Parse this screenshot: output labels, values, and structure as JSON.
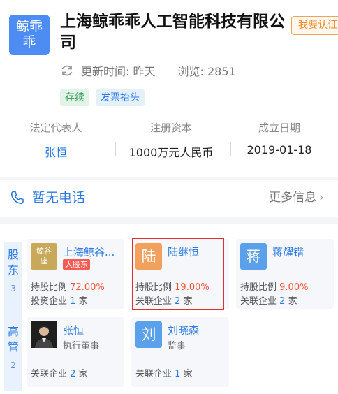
{
  "company": {
    "logo_lines": [
      "鲸乖",
      "乖"
    ],
    "name": "上海鲸乖乖人工智能科技有限公司",
    "claim_button": "我要认证",
    "updated": "更新时间: 昨天",
    "views": "浏览: 2851",
    "tags": [
      "存续",
      "发票抬头"
    ]
  },
  "info": {
    "legal_rep_label": "法定代表人",
    "legal_rep_value": "张恒",
    "capital_label": "注册资本",
    "capital_value": "1000万元人民币",
    "date_label": "成立日期",
    "date_value": "2019-01-18"
  },
  "phone": {
    "text": "暂无电话",
    "more": "更多信息"
  },
  "shareholders": {
    "label": "股东",
    "count": "3",
    "items": [
      {
        "avatar_lines": [
          "鲸谷",
          "座"
        ],
        "name": "上海鲸谷...",
        "badge": "大股东",
        "ratio_label": "持股比例",
        "ratio": "72.00%",
        "related_label": "投资企业",
        "related_count": "1",
        "related_unit": "家"
      },
      {
        "avatar": "陆",
        "name": "陆继恒",
        "ratio_label": "持股比例",
        "ratio": "19.00%",
        "related_label": "关联企业",
        "related_count": "2",
        "related_unit": "家"
      },
      {
        "avatar": "蒋",
        "name": "蒋耀锴",
        "ratio_label": "持股比例",
        "ratio": "9.00%",
        "related_label": "关联企业",
        "related_count": "2",
        "related_unit": "家"
      }
    ]
  },
  "executives": {
    "label": "高管",
    "count": "2",
    "items": [
      {
        "name": "张恒",
        "role": "执行董事",
        "related_label": "关联企业",
        "related_count": "2",
        "related_unit": "家"
      },
      {
        "avatar": "刘",
        "name": "刘晓森",
        "role": "监事",
        "related_label": "关联企业",
        "related_count": "1",
        "related_unit": "家"
      }
    ]
  },
  "colors": {
    "accent": "#2d7be0",
    "logo": "#4c8cf3",
    "claim": "#f08a24",
    "highlight": "#e0302f",
    "percent": "#f0553a"
  }
}
